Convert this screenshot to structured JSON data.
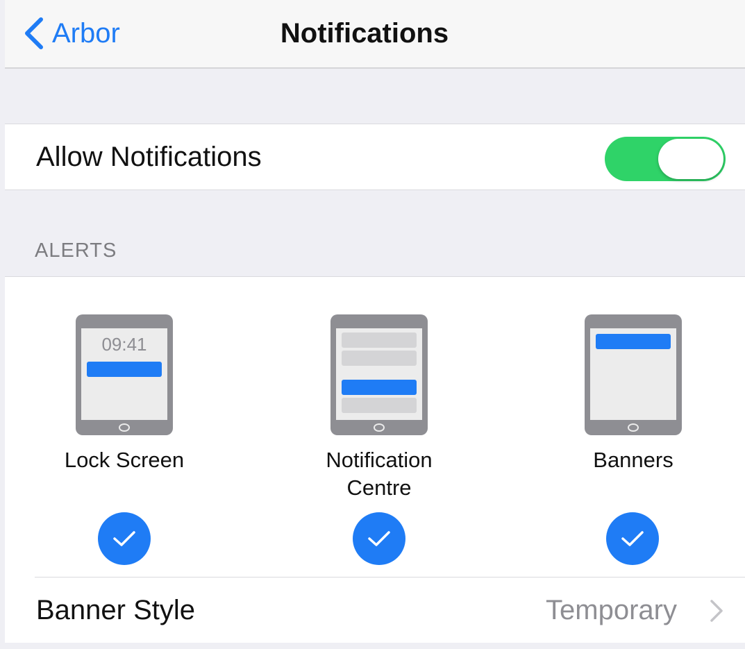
{
  "nav": {
    "back_label": "Arbor",
    "title": "Notifications"
  },
  "allow_notifications": {
    "label": "Allow Notifications",
    "enabled": true
  },
  "alerts": {
    "header": "ALERTS",
    "options": [
      {
        "label": "Lock Screen",
        "clock": "09:41",
        "checked": true
      },
      {
        "label": "Notification\nCentre",
        "checked": true
      },
      {
        "label": "Banners",
        "checked": true
      }
    ]
  },
  "banner_style": {
    "label": "Banner Style",
    "value": "Temporary"
  },
  "colors": {
    "accent": "#1f7cf5",
    "toggle_on": "#2fd368",
    "background": "#efeff4"
  }
}
